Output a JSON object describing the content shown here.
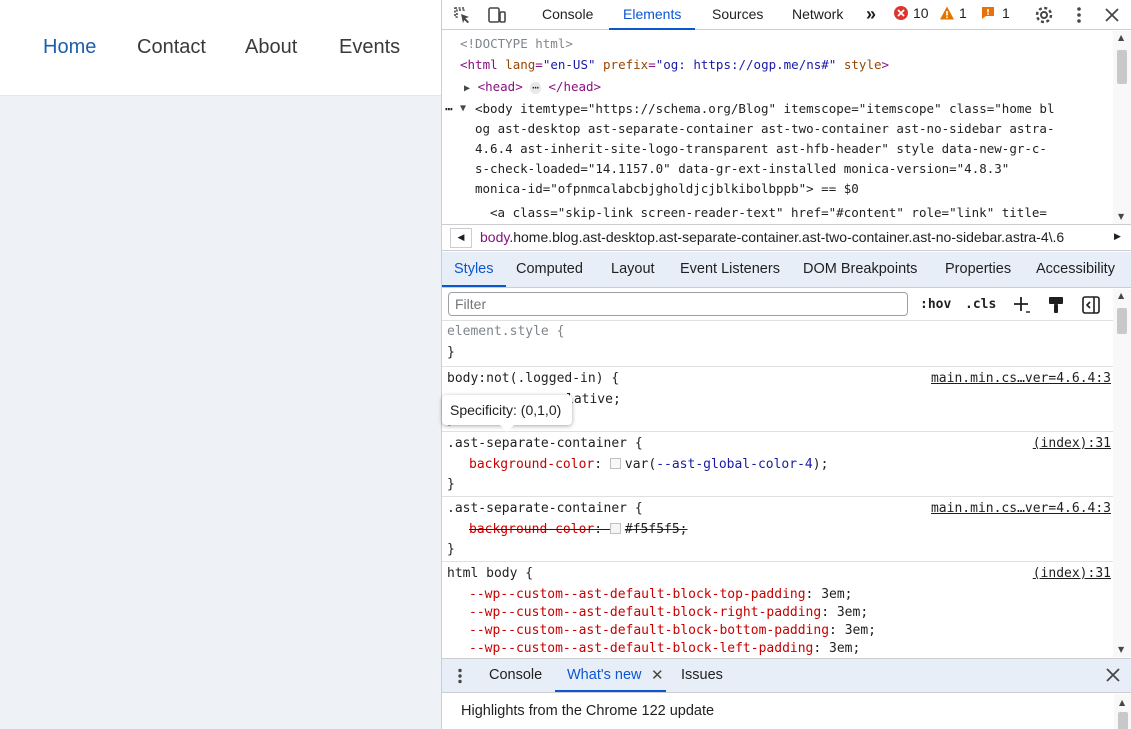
{
  "site": {
    "nav": [
      "Home",
      "Contact",
      "About",
      "Events"
    ]
  },
  "devtools": {
    "tabs": [
      "Console",
      "Elements",
      "Sources",
      "Network"
    ],
    "more_tabs": "»",
    "errors_count": "10",
    "warnings_count": "1",
    "issues_count": "1",
    "elements": {
      "doctype": "<!DOCTYPE html>",
      "html_line": {
        "tag_open": "<html",
        "a1": "lang",
        "v1": "\"en-US\"",
        "a2": "prefix",
        "v2": "\"og: https://ogp.me/ns#\"",
        "a3": "style",
        "tag_close": ">"
      },
      "head_line": {
        "open": "<head>",
        "ellipsis": "⋯",
        "close": "</head>"
      },
      "body_lines": [
        "<body itemtype=\"https://schema.org/Blog\" itemscope=\"itemscope\" class=\"home bl",
        "og ast-desktop ast-separate-container ast-two-container ast-no-sidebar astra-",
        "4.6.4 ast-inherit-site-logo-transparent ast-hfb-header\" style data-new-gr-c-",
        "s-check-loaded=\"14.1157.0\" data-gr-ext-installed monica-version=\"4.8.3\"",
        "monica-id=\"ofpnmcalabcbjgholdjcjblkibolbppb\"> == $0"
      ],
      "skip_line": "<a class=\"skip-link screen-reader-text\" href=\"#content\" role=\"link\" title="
    },
    "breadcrumb": {
      "tag": "body",
      "classes": ".home.blog.ast-desktop.ast-separate-container.ast-two-container.ast-no-sidebar.astra-4\\.6"
    },
    "style_tabs": [
      "Styles",
      "Computed",
      "Layout",
      "Event Listeners",
      "DOM Breakpoints",
      "Properties",
      "Accessibility"
    ],
    "filter_placeholder": "Filter",
    "hov_label": ":hov",
    "cls_label": ".cls",
    "tooltip": "Specificity: (0,1,0)",
    "rules": {
      "r1": {
        "selector": "element.style {",
        "close": "}"
      },
      "r2": {
        "selector": "body:not(.logged-in) {",
        "source": "main.min.cs…ver=4.6.4:3",
        "decl_value": "lative;",
        "close": "}"
      },
      "r3": {
        "selector": ".ast-separate-container {",
        "source": "(index):31",
        "prop": "background-color",
        "value_pre": "var(",
        "value_var": "--ast-global-color-4",
        "value_post": ");",
        "close": "}"
      },
      "r4": {
        "selector": ".ast-separate-container {",
        "source": "main.min.cs…ver=4.6.4:3",
        "prop": "background-color",
        "value": "#f5f5f5;",
        "close": "}"
      },
      "r5": {
        "selector": "html body {",
        "source": "(index):31",
        "decls": [
          {
            "prop": "--wp--custom--ast-default-block-top-padding",
            "value": "3em;"
          },
          {
            "prop": "--wp--custom--ast-default-block-right-padding",
            "value": "3em;"
          },
          {
            "prop": "--wp--custom--ast-default-block-bottom-padding",
            "value": "3em;"
          },
          {
            "prop": "--wp--custom--ast-default-block-left-padding",
            "value": "3em;"
          }
        ]
      }
    },
    "drawer_tabs": [
      "Console",
      "What's new",
      "Issues"
    ],
    "whats_new_text": "Highlights from the Chrome 122 update",
    "colors": {
      "accent": "#0b57d0",
      "error": "#dc362e",
      "warning": "#e37400",
      "issue": "#e8710a"
    }
  }
}
